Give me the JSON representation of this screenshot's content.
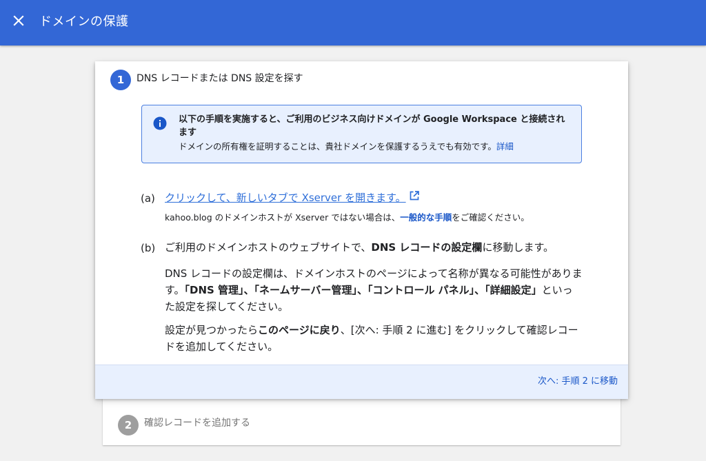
{
  "header": {
    "title": "ドメインの保護",
    "close_icon": "close-icon"
  },
  "step1": {
    "number": "1",
    "title": "DNS レコードまたは DNS 設定を探す",
    "info": {
      "icon": "info-icon",
      "title": "以下の手順を実施すると、ご利用のビジネス向けドメインが Google Workspace と接続されます",
      "desc": "ドメインの所有権を証明することは、貴社ドメインを保護するうえでも有効です。",
      "link": "詳細"
    },
    "item_a": {
      "marker": "(a)",
      "link": "クリックして、新しいタブで Xserver を開きます。",
      "link_icon": "open-in-new-icon",
      "note_before": "kahoo.blog のドメインホストが Xserver ではない場合は、",
      "note_link": "一般的な手順",
      "note_after": "をご確認ください。"
    },
    "item_b": {
      "marker": "(b)",
      "main_before": "ご利用のドメインホストのウェブサイトで、",
      "main_bold": "DNS レコードの設定欄",
      "main_after": "に移動します。",
      "p1_before": "DNS レコードの設定欄は、ドメインホストのページによって名称が異なる可能性があります。",
      "p1_bold": "「DNS 管理」、「ネームサーバー管理」、「コントロール パネル」、「詳細設定」",
      "p1_after": "といった設定を探してください。",
      "p2_before": "設定が見つかったら",
      "p2_bold": "このページに戻り",
      "p2_after": "、[次へ: 手順 2 に進む] をクリックして確認レコードを追加してください。"
    },
    "footer_button": "次へ: 手順 2 に移動"
  },
  "step2": {
    "number": "2",
    "title": "確認レコードを追加する"
  },
  "colors": {
    "header": "#3367d6",
    "accent": "#1a57c8",
    "info_bg": "#e8f0fe",
    "inactive_step": "#9e9e9e"
  }
}
